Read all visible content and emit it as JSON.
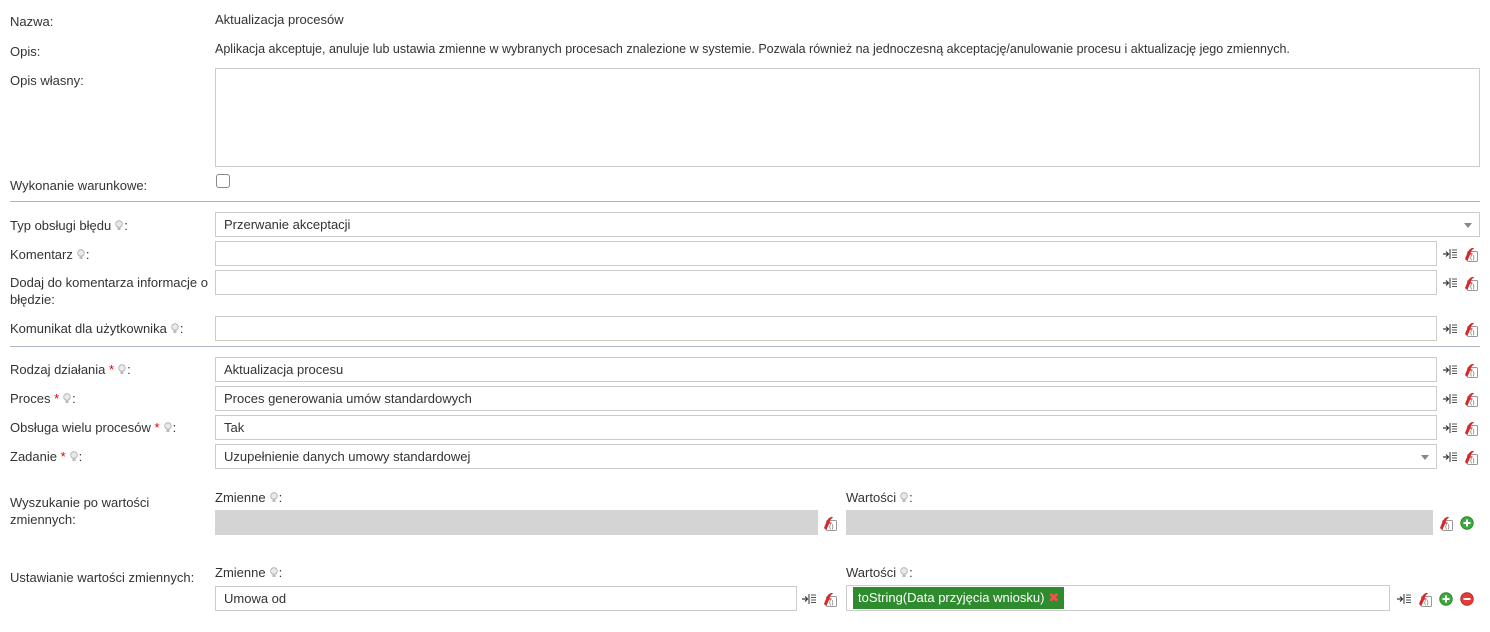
{
  "info": {
    "name_label": "Nazwa:",
    "name_value": "Aktualizacja procesów",
    "desc_label": "Opis:",
    "desc_value": "Aplikacja akceptuje, anuluje lub ustawia zmienne w wybranych procesach znalezione w systemie. Pozwala również na jednoczesną akceptację/anulowanie procesu i aktualizację jego zmiennych.",
    "own_desc_label": "Opis własny:",
    "own_desc_value": "",
    "conditional_label": "Wykonanie warunkowe:",
    "conditional_checked": false
  },
  "error_section": {
    "error_type_label": "Typ obsługi błędu",
    "error_type_value": "Przerwanie akceptacji",
    "comment_label": "Komentarz",
    "comment_value": "",
    "add_info_label_1": "Dodaj do komentarza informacje o",
    "add_info_label_2": "błędzie:",
    "add_info_value": "",
    "user_msg_label": "Komunikat dla użytkownika",
    "user_msg_value": ""
  },
  "action_section": {
    "action_label": "Rodzaj działania",
    "action_value": "Aktualizacja procesu",
    "process_label": "Proces",
    "process_value": "Proces generowania umów standardowych",
    "multi_label": "Obsługa wielu procesów",
    "multi_value": "Tak",
    "task_label": "Zadanie",
    "task_value": "Uzupełnienie danych umowy standardowej",
    "required_mark": "*",
    "colon": ":"
  },
  "search_vars": {
    "label_1": "Wyszukanie po wartości",
    "label_2": "zmiennych:",
    "variables_label": "Zmienne",
    "values_label": "Wartości",
    "variables_value": "",
    "values_value": ""
  },
  "set_vars": {
    "label": "Ustawianie wartości zmiennych:",
    "variables_label": "Zmienne",
    "values_label": "Wartości",
    "variables_value": "Umowa od",
    "values_chip": "toString(Data przyjęcia wniosku)",
    "chip_remove": "✖"
  },
  "colors": {
    "chip_bg": "#2e8b2e",
    "required": "#dd0000",
    "add_green": "#3da83d",
    "remove_red": "#e23b3b",
    "separator": "#a9b6c6"
  },
  "icons": [
    "hint-bulb-icon",
    "insert-variable-icon",
    "function-editor-icon",
    "add-icon",
    "remove-icon",
    "dropdown-caret-icon"
  ]
}
